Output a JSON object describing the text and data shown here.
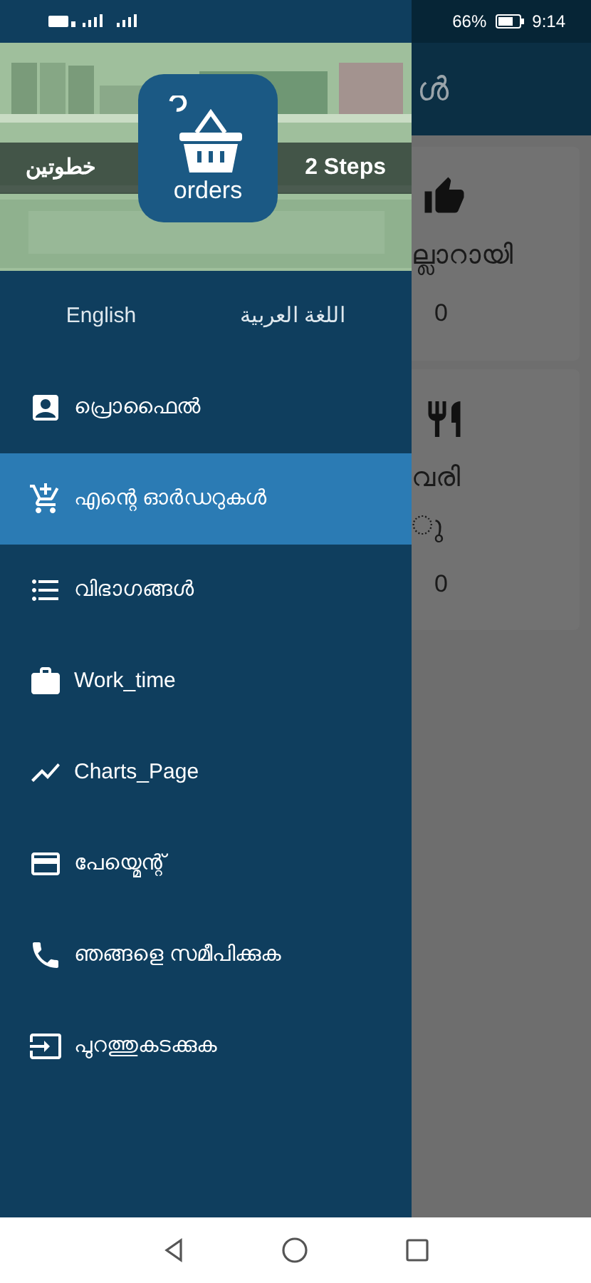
{
  "status_bar": {
    "battery": "66%",
    "time": "9:14"
  },
  "drawer": {
    "header": {
      "left_text": "خطوتين",
      "right_text": "2 Steps",
      "logo_text": "orders"
    },
    "languages": [
      {
        "label": "English"
      },
      {
        "label": "اللغة العربية"
      }
    ],
    "menu": [
      {
        "kind": "profile",
        "label": "പ്രൊഫൈൽ",
        "selected": false
      },
      {
        "kind": "cart",
        "label": "എന്റെ ഓർഡറുകൾ",
        "selected": true
      },
      {
        "kind": "list",
        "label": "വിഭാഗങ്ങൾ",
        "selected": false
      },
      {
        "kind": "work",
        "label": "Work_time",
        "selected": false
      },
      {
        "kind": "chart",
        "label": "Charts_Page",
        "selected": false
      },
      {
        "kind": "card",
        "label": "പേയ്മെന്റ്",
        "selected": false
      },
      {
        "kind": "phone",
        "label": "ഞങ്ങളെ സമീപിക്കുക",
        "selected": false
      },
      {
        "kind": "exit",
        "label": "പുറത്തുകടക്കുക",
        "selected": false
      }
    ]
  },
  "background": {
    "title": "ൾ",
    "cards": [
      {
        "kind": "thumb",
        "label_lines": [
          "ല്ലാറായി"
        ],
        "count": "0"
      },
      {
        "kind": "cutlery",
        "label_lines": [
          "വരി",
          "ു"
        ],
        "count": "0"
      }
    ]
  }
}
